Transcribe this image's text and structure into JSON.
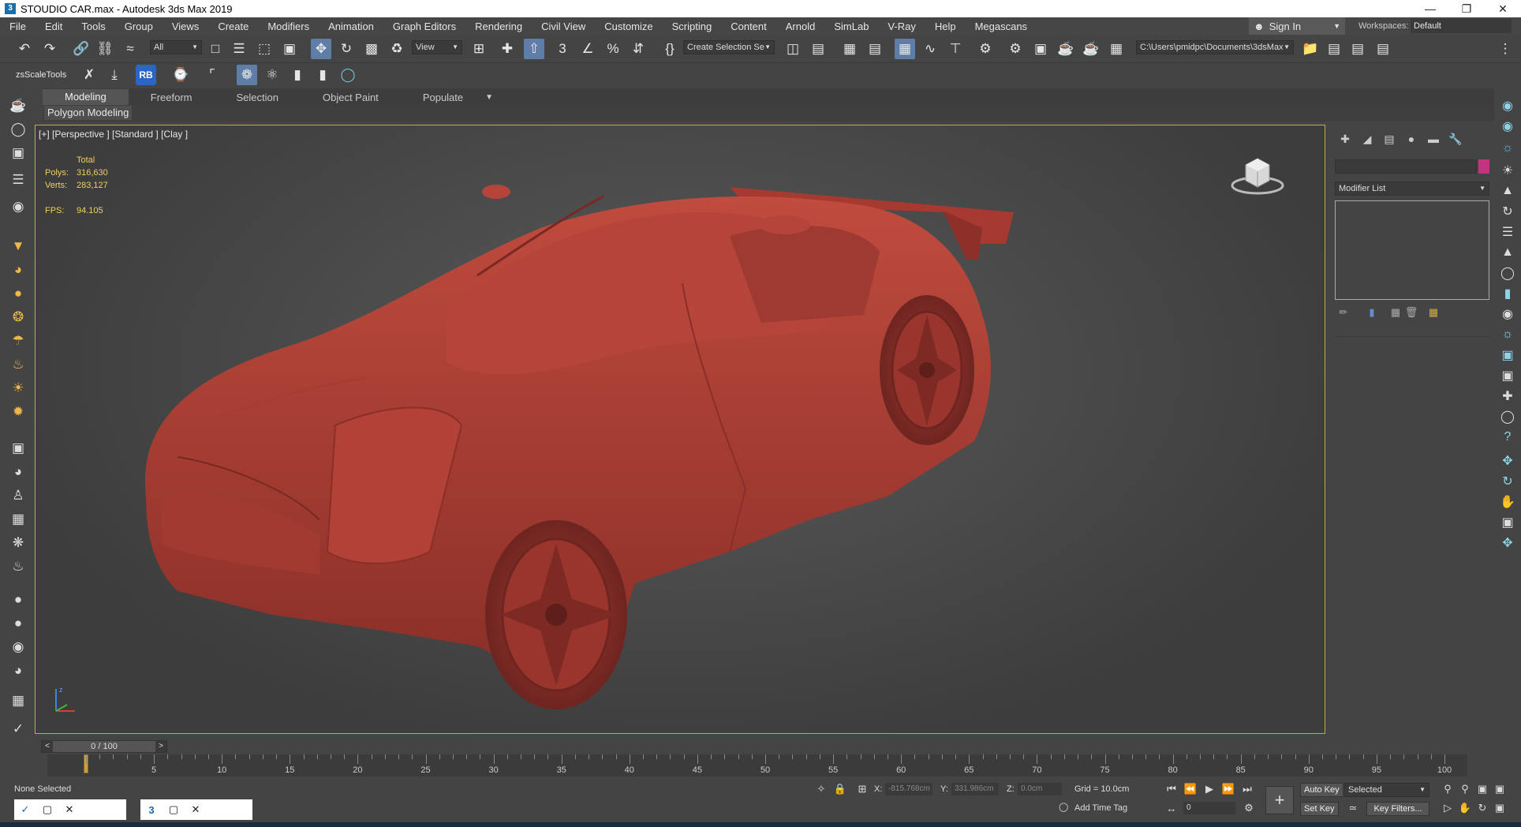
{
  "window": {
    "title": "STOUDIO  CAR.max - Autodesk 3ds Max 2019",
    "app_icon": "3",
    "minimize": "—",
    "restore": "❐",
    "close": "✕"
  },
  "menu": [
    "File",
    "Edit",
    "Tools",
    "Group",
    "Views",
    "Create",
    "Modifiers",
    "Animation",
    "Graph Editors",
    "Rendering",
    "Civil View",
    "Customize",
    "Scripting",
    "Content",
    "Arnold",
    "SimLab",
    "V-Ray",
    "Help",
    "Megascans"
  ],
  "signin": {
    "label": "Sign In"
  },
  "workspaces": {
    "label": "Workspaces:",
    "value": "Default"
  },
  "toolbar": {
    "selection_filter": "All",
    "ref_coord": "View",
    "named_selection": "Create Selection Se",
    "project_path": "C:\\Users\\pmidpc\\Documents\\3dsMax"
  },
  "toolbar2": {
    "zs_label": "zsScaleTools",
    "rb_label": "RB"
  },
  "ribbon": {
    "tabs": [
      "Modeling",
      "Freeform",
      "Selection",
      "Object Paint",
      "Populate"
    ],
    "active_tab": "Modeling",
    "subpanel": "Polygon Modeling"
  },
  "viewport": {
    "label": "[+] [Perspective ] [Standard ] [Clay ]",
    "stats": {
      "total_label": "Total",
      "polys_label": "Polys:",
      "polys": "316,630",
      "verts_label": "Verts:",
      "verts": "283,127",
      "fps_label": "FPS:",
      "fps": "94.105"
    },
    "model_color": "#b0443a",
    "axis_label": "z"
  },
  "command_panel": {
    "modifier_list": "Modifier List",
    "object_color": "#c2347e"
  },
  "timeline": {
    "slider": "0 / 100",
    "ticks": [
      5,
      10,
      15,
      20,
      25,
      30,
      35,
      40,
      45,
      50,
      55,
      60,
      65,
      70,
      75,
      80,
      85,
      90,
      95,
      100
    ]
  },
  "status": {
    "selection": "None Selected",
    "x_label": "X:",
    "x": "-815.768cm",
    "y_label": "Y:",
    "y": "331.986cm",
    "z_label": "Z:",
    "z": "0.0cm",
    "grid": "Grid = 10.0cm",
    "add_time_tag": "Add Time Tag",
    "auto_key": "Auto Key",
    "set_key": "Set Key",
    "key_mode": "Selected",
    "key_filters": "Key Filters...",
    "frame": "0"
  }
}
